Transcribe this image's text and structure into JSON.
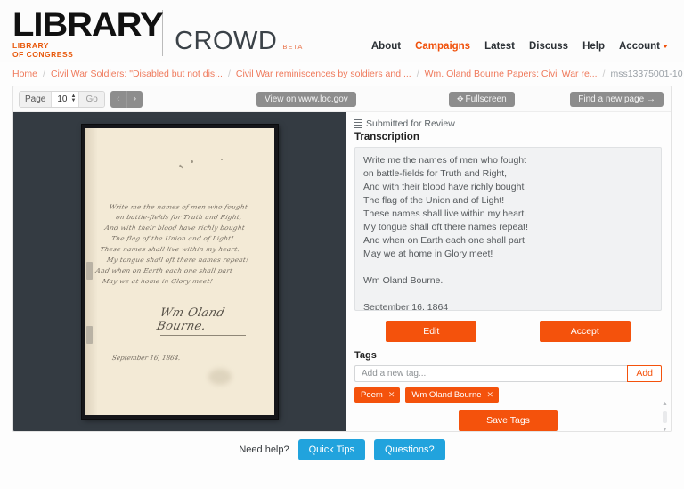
{
  "header": {
    "logo_primary": "LIBRARY",
    "logo_sub_line1": "LIBRARY",
    "logo_sub_line2": "OF CONGRESS",
    "product_name": "CROWD",
    "beta_tag": "BETA",
    "nav": [
      {
        "label": "About",
        "active": false
      },
      {
        "label": "Campaigns",
        "active": true
      },
      {
        "label": "Latest",
        "active": false
      },
      {
        "label": "Discuss",
        "active": false
      },
      {
        "label": "Help",
        "active": false
      },
      {
        "label": "Account",
        "active": false,
        "has_caret": true
      }
    ]
  },
  "breadcrumb": {
    "items": [
      "Home",
      "Civil War Soldiers: \"Disabled but not dis...",
      "Civil War reminiscences by soldiers and ...",
      "Wm. Oland Bourne Papers: Civil War re..."
    ],
    "current": "mss13375001-10",
    "separator": "/"
  },
  "toolbar": {
    "page_label": "Page",
    "page_value": "10",
    "go_label": "Go",
    "prev_arrow": "‹",
    "next_arrow": "›",
    "view_on_loc": "View on www.loc.gov",
    "fullscreen": "Fullscreen",
    "fullscreen_icon": "✥",
    "find_new_page": "Find a new page →"
  },
  "viewer": {
    "manuscript_lines": [
      "Write me the names of men who fought",
      "on battle-fields for Truth and Right,",
      "And with their blood have richly bought",
      "The flag of the Union and of Light!",
      "These names shall live within my heart.",
      "My tongue shall oft there names repeat!",
      "And when on Earth each one shall part",
      "May we at home in Glory meet!"
    ],
    "signature": "Wm Oland Bourne.",
    "date_written": "September 16, 1864."
  },
  "panel": {
    "status": "Submitted for Review",
    "status_icon": "list-icon",
    "title": "Transcription",
    "transcription": "Write me the names of men who fought\non battle-fields for Truth and Right,\nAnd with their blood have richly bought\nThe flag of the Union and of Light!\nThese names shall live within my heart.\nMy tongue shall oft there names repeat!\nAnd when on Earth each one shall part\nMay we at home in Glory meet!\n\nWm Oland Bourne.\n\nSeptember 16, 1864",
    "edit_label": "Edit",
    "accept_label": "Accept",
    "tags_title": "Tags",
    "tag_placeholder": "Add a new tag...",
    "tag_value": "",
    "add_label": "Add",
    "tags": [
      {
        "label": "Poem",
        "remove": "✕"
      },
      {
        "label": "Wm Oland Bourne",
        "remove": "✕"
      }
    ],
    "save_tags_label": "Save Tags"
  },
  "footer": {
    "need_help": "Need help?",
    "quick_tips": "Quick Tips",
    "questions": "Questions?"
  },
  "colors": {
    "brand_orange": "#f4520c",
    "logo_orange": "#e8590c",
    "breadcrumb_link": "#ef7a5c",
    "viewer_bg": "#343b42",
    "help_blue": "#21a3dd",
    "gray_button": "#8d8d8d"
  }
}
